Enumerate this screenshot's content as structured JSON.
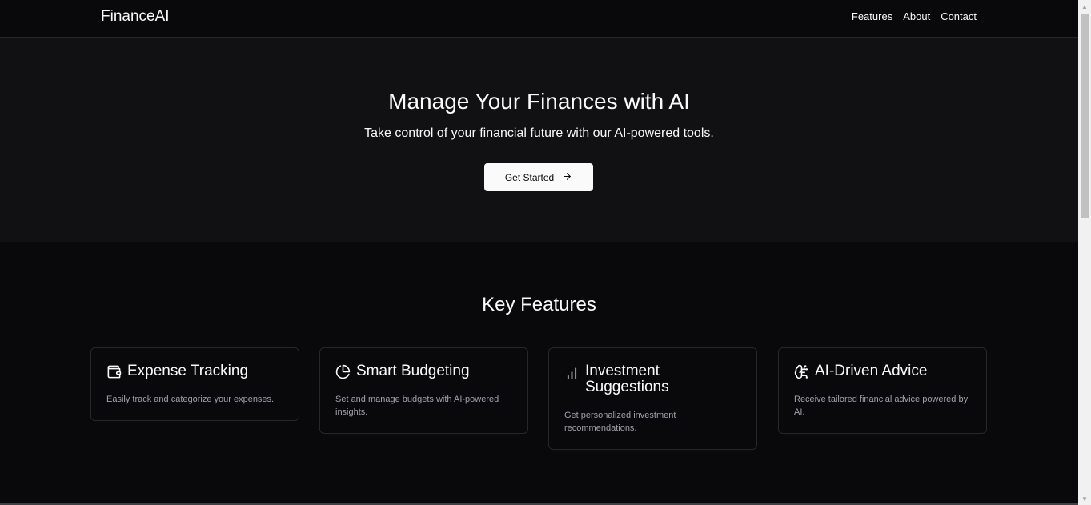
{
  "header": {
    "brand": "FinanceAI",
    "nav": [
      "Features",
      "About",
      "Contact"
    ]
  },
  "hero": {
    "title": "Manage Your Finances with AI",
    "subtitle": "Take control of your financial future with our AI-powered tools.",
    "cta_label": "Get Started",
    "cta_icon": "arrow-right-icon"
  },
  "features": {
    "title": "Key Features",
    "cards": [
      {
        "icon": "wallet-icon",
        "title": "Expense Tracking",
        "description": "Easily track and categorize your expenses."
      },
      {
        "icon": "pie-chart-icon",
        "title": "Smart Budgeting",
        "description": "Set and manage budgets with AI-powered insights."
      },
      {
        "icon": "bar-chart-icon",
        "title": "Investment Suggestions",
        "description": "Get personalized investment recommendations."
      },
      {
        "icon": "brain-icon",
        "title": "AI-Driven Advice",
        "description": "Receive tailored financial advice powered by AI."
      }
    ]
  },
  "colors": {
    "background": "#09090b",
    "hero_background": "#111113",
    "foreground": "#fafafa",
    "muted": "#a1a1aa",
    "border": "#27272a"
  }
}
